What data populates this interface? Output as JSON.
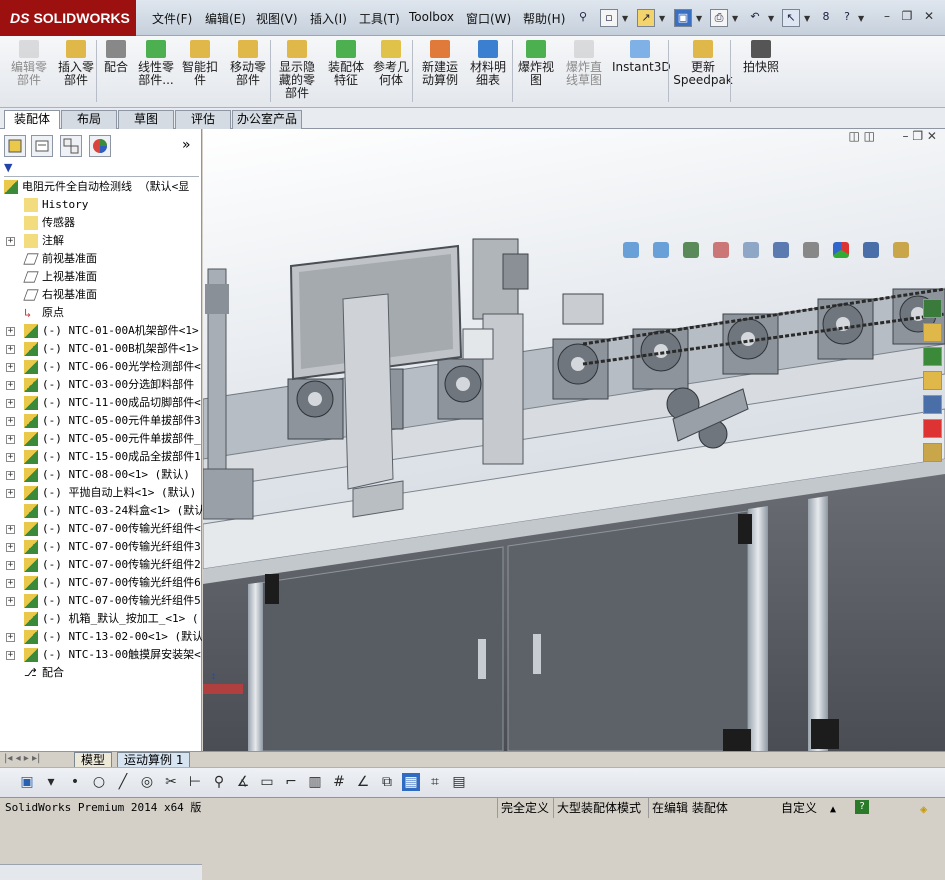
{
  "app": {
    "logo_ds": "DS",
    "logo_name": "SOLIDWORKS"
  },
  "menu": [
    "文件(F)",
    "编辑(E)",
    "视图(V)",
    "插入(I)",
    "工具(T)",
    "Toolbox",
    "窗口(W)",
    "帮助(H)"
  ],
  "commands": [
    {
      "label": "编辑零\n部件",
      "disabled": true,
      "icon": "edit-component-icon"
    },
    {
      "label": "插入零\n部件",
      "disabled": false,
      "icon": "insert-components-icon"
    },
    {
      "label": "配合",
      "disabled": false,
      "icon": "mate-icon"
    },
    {
      "label": "线性零\n部件...",
      "disabled": false,
      "icon": "linear-pattern-icon"
    },
    {
      "label": "智能扣\n件",
      "disabled": false,
      "icon": "smart-fasteners-icon"
    },
    {
      "label": "移动零\n部件",
      "disabled": false,
      "icon": "move-component-icon"
    },
    {
      "label": "显示隐\n藏的零\n部件",
      "disabled": false,
      "icon": "show-hidden-icon"
    },
    {
      "label": "装配体\n特征",
      "disabled": false,
      "icon": "assembly-features-icon"
    },
    {
      "label": "参考几\n何体",
      "disabled": false,
      "icon": "reference-geometry-icon"
    },
    {
      "label": "新建运\n动算例",
      "disabled": false,
      "icon": "new-motion-study-icon"
    },
    {
      "label": "材料明\n细表",
      "disabled": false,
      "icon": "bill-of-materials-icon"
    },
    {
      "label": "爆炸视\n图",
      "disabled": false,
      "icon": "exploded-view-icon"
    },
    {
      "label": "爆炸直\n线草图",
      "disabled": true,
      "icon": "explode-line-sketch-icon"
    },
    {
      "label": "Instant3D",
      "disabled": false,
      "icon": "instant3d-icon"
    },
    {
      "label": "更新\nSpeedpak",
      "disabled": false,
      "icon": "speedpak-icon"
    },
    {
      "label": "拍快照",
      "disabled": false,
      "icon": "snapshot-icon"
    }
  ],
  "tabs": [
    "装配体",
    "布局",
    "草图",
    "评估",
    "办公室产品"
  ],
  "tree": {
    "root": "电阻元件全自动检测线 （默认<显",
    "items": [
      {
        "label": "History",
        "icon": "history-icon",
        "exp": false
      },
      {
        "label": "传感器",
        "icon": "sensor-icon",
        "exp": false
      },
      {
        "label": "注解",
        "icon": "annotation-icon",
        "exp": true
      },
      {
        "label": "前视基准面",
        "icon": "plane-icon",
        "exp": false
      },
      {
        "label": "上视基准面",
        "icon": "plane-icon",
        "exp": false
      },
      {
        "label": "右视基准面",
        "icon": "plane-icon",
        "exp": false
      },
      {
        "label": "原点",
        "icon": "origin-icon",
        "exp": false
      },
      {
        "label": "(-) NTC-01-00A机架部件<1>",
        "icon": "subassembly-icon",
        "exp": true
      },
      {
        "label": "(-) NTC-01-00B机架部件<1>",
        "icon": "subassembly-icon",
        "exp": true
      },
      {
        "label": "(-) NTC-06-00光学检测部件<",
        "icon": "subassembly-icon",
        "exp": true
      },
      {
        "label": "(-) NTC-03-00分选卸料部件",
        "icon": "subassembly-icon",
        "exp": true
      },
      {
        "label": "(-) NTC-11-00成品切脚部件<",
        "icon": "subassembly-icon",
        "exp": true
      },
      {
        "label": "(-) NTC-05-00元件单拔部件3",
        "icon": "subassembly-icon",
        "exp": true
      },
      {
        "label": "(-) NTC-05-00元件单拔部件_",
        "icon": "subassembly-icon",
        "exp": true
      },
      {
        "label": "(-) NTC-15-00成品全拔部件1",
        "icon": "subassembly-icon",
        "exp": true
      },
      {
        "label": "(-) NTC-08-00<1> (默认)",
        "icon": "subassembly-icon",
        "exp": true
      },
      {
        "label": "(-) 平抛自动上料<1> (默认)",
        "icon": "subassembly-icon",
        "exp": true
      },
      {
        "label": "(-) NTC-03-24料盒<1> (默认",
        "icon": "subassembly-icon",
        "exp": false
      },
      {
        "label": "(-) NTC-07-00传输光纤组件<",
        "icon": "subassembly-icon",
        "exp": true
      },
      {
        "label": "(-) NTC-07-00传输光纤组件3",
        "icon": "subassembly-icon",
        "exp": true
      },
      {
        "label": "(-) NTC-07-00传输光纤组件2",
        "icon": "subassembly-icon",
        "exp": true
      },
      {
        "label": "(-) NTC-07-00传输光纤组件6",
        "icon": "subassembly-icon",
        "exp": true
      },
      {
        "label": "(-) NTC-07-00传输光纤组件5",
        "icon": "subassembly-icon",
        "exp": true
      },
      {
        "label": "(-) 机箱_默认_按加工_<1> (",
        "icon": "subassembly-icon",
        "exp": false
      },
      {
        "label": "(-) NTC-13-02-00<1> (默认)",
        "icon": "subassembly-icon",
        "exp": true
      },
      {
        "label": "(-) NTC-13-00触摸屏安装架<",
        "icon": "subassembly-icon",
        "exp": true
      },
      {
        "label": "配合",
        "icon": "mates-folder-icon",
        "exp": false
      }
    ]
  },
  "bottom_tabs": [
    "模型",
    "运动算例 1"
  ],
  "status": {
    "product": "SolidWorks Premium 2014 x64 版",
    "cells": [
      "完全定义",
      "大型装配体模式",
      "在编辑 装配体",
      "自定义"
    ]
  },
  "colors": {
    "brand": "#9c1010",
    "accent": "#2a5fb0"
  }
}
